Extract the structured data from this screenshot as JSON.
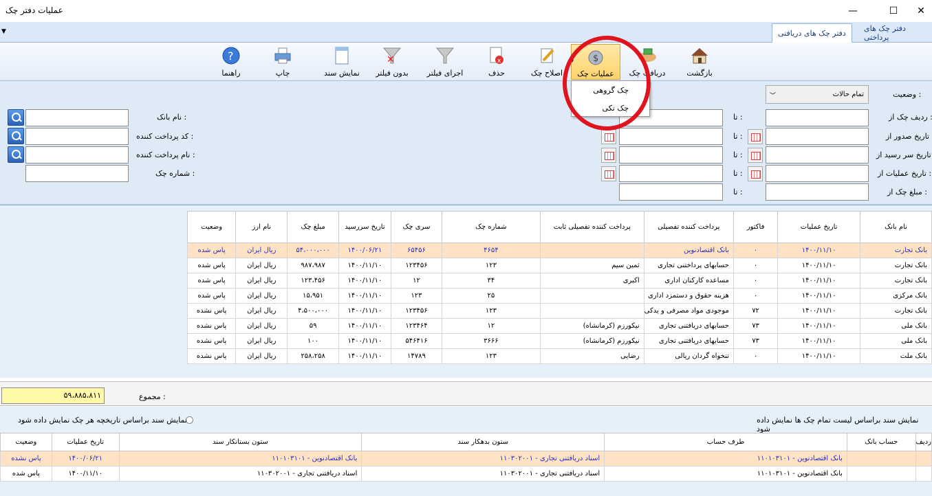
{
  "window": {
    "title": "عملیات دفتر چک",
    "minimize": "—",
    "maximize": "☐",
    "close": "✕"
  },
  "tabs": [
    {
      "label": "دفتر چک های پرداختی"
    },
    {
      "label": "دفتر چک های دریافتی"
    }
  ],
  "toolbar": {
    "back": "بازگشت",
    "receive_check": "دریافت چک",
    "check_ops": "عملیات چک",
    "edit_check": "اصلاح چک",
    "delete": "حذف",
    "apply_filter": "اجرای فیلتر",
    "no_filter": "بدون فیلتر",
    "show_document": "نمایش سند",
    "print": "چاپ",
    "help": "راهنما"
  },
  "dropdown_menu": {
    "items": [
      "چک گروهی",
      "چک تکی"
    ]
  },
  "filters": {
    "status_label": "وضعیت :",
    "status_value": "تمام حالات",
    "serial_from": "ردیف چک از :",
    "issue_date_from": "تاریخ صدور از :",
    "due_date_from": "تاریخ سر رسید از :",
    "ops_date_from": "تاریخ عملیات از :",
    "amount_from": "مبلغ چک از :",
    "to": "تا :",
    "bank_name": "نام بانک :",
    "payer_code": "کد پرداخت کننده :",
    "payer_name": "نام پرداخت کننده :",
    "check_number": "شماره چک :"
  },
  "grid": {
    "headers": [
      "نام بانک",
      "تاریخ عملیات",
      "فاکتور",
      "پرداخت کننده تفصیلی",
      "پرداخت کننده تفصیلی ثابت",
      "شماره چک",
      "سری چک",
      "تاریخ سررسید",
      "مبلغ چک",
      "نام ارز",
      "وضعیت"
    ],
    "rows": [
      [
        "بانک تجارت",
        "۱۴۰۰/۱۱/۱۰",
        "۰",
        "بانک اقتصادنوین",
        "",
        "۴۶۵۴",
        "۶۵۴۵۶",
        "۱۴۰۰/۰۶/۲۱",
        "۵۴،۰۰۰،۰۰۰",
        "ریال ایران",
        "پاس شده"
      ],
      [
        "بانک تجارت",
        "۱۴۰۰/۱۱/۱۰",
        "۰",
        "حسابهای پرداختنی تجاری",
        "ثمین سیم",
        "۱۲۳",
        "۱۲۳۴۵۶",
        "۱۴۰۰/۱۱/۱۰",
        "۹۸۷،۹۸۷",
        "ریال ایران",
        "پاس شده"
      ],
      [
        "بانک تجارت",
        "۱۴۰۰/۱۱/۱۰",
        "۰",
        "مساعده کارکنان اداری",
        "اکبری",
        "۳۴",
        "۱۲",
        "۱۴۰۰/۱۱/۱۰",
        "۱۲۳،۴۵۶",
        "ریال ایران",
        "پاس شده"
      ],
      [
        "بانک مرکزی",
        "۱۴۰۰/۱۱/۱۰",
        "۰",
        "هزینه حقوق و دستمزد اداری",
        "",
        "۲۵",
        "۱۲۳",
        "۱۴۰۰/۱۱/۱۰",
        "۱۵،۹۵۱",
        "ریال ایران",
        "پاس شده"
      ],
      [
        "بانک تجارت",
        "۱۴۰۰/۱۱/۱۰",
        "۷۲",
        "موجودی مواد مصرفی و یدکی",
        "",
        "۱۲۳",
        "۱۲۳۴۵۶",
        "۱۴۰۰/۱۱/۱۰",
        "۴،۵۰۰،۰۰۰",
        "ریال ایران",
        "پاس نشده"
      ],
      [
        "بانک ملی",
        "۱۴۰۰/۱۱/۱۰",
        "۷۳",
        "حسابهای دریافتنی تجاری",
        "نیکورزم (کرمانشاه)",
        "۱۲",
        "۱۲۳۴۶۴",
        "۱۴۰۰/۱۱/۱۰",
        "۵۹",
        "ریال ایران",
        "پاس نشده"
      ],
      [
        "بانک ملی",
        "۱۴۰۰/۱۱/۱۰",
        "۷۳",
        "حسابهای دریافتنی تجاری",
        "نیکورزم (کرمانشاه)",
        "۳۶۶۶",
        "۵۴۶۴۱۶",
        "۱۴۰۰/۱۱/۱۰",
        "۱۰۰",
        "ریال ایران",
        "پاس نشده"
      ],
      [
        "بانک ملت",
        "۱۴۰۰/۱۱/۱۰",
        "۰",
        "تنخواه گردان ریالی",
        "رضایی",
        "۱۲۳",
        "۱۴۷۸۹",
        "۱۴۰۰/۱۱/۱۰",
        "۲۵۸،۲۵۸",
        "ریال ایران",
        "پاس نشده"
      ]
    ]
  },
  "total": {
    "label": "مجموع :",
    "value": "۵۹،۸۸۵،۸۱۱"
  },
  "radio": {
    "opt1": "نمایش سند براساس لیست تمام چک ها نمایش داده شود",
    "opt2": "نمایش سند براساس تاریخچه هر چک نمایش داده شود"
  },
  "grid2": {
    "headers": [
      "ردیف",
      "حساب بانک",
      "طرف حساب",
      "ستون بدهکار سند",
      "ستون بستانکار سند",
      "تاریخ عملیات",
      "وضعیت"
    ],
    "rows": [
      [
        "",
        "",
        "۱۱۰۱۰۳۱۰۱ - بانک اقتصادنوین",
        "۱۱۰۳۰۲۰۰۱ - اسناد دریافتنی تجاری",
        "۱۱۰۱۰۳۱۰۱ - بانک اقتصادنوین",
        "۱۴۰۰/۰۶/۲۱",
        "پاس نشده"
      ],
      [
        "",
        "",
        "۱۱۰۱۰۳۱۰۱ - بانک اقتصادنوین",
        "۱۱۰۳۰۲۰۰۱ - اسناد دریافتنی تجاری",
        "۱۱۰۳۰۲۰۰۱ - اسناد دریافتنی تجاری",
        "۱۴۰۰/۱۱/۱۰",
        "پاس شده"
      ]
    ]
  }
}
